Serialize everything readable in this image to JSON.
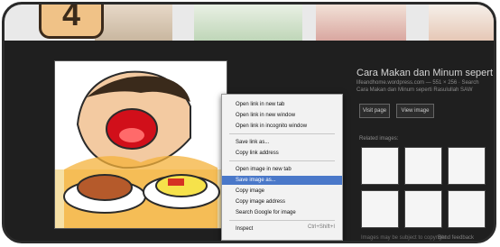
{
  "step": {
    "number": "4"
  },
  "info": {
    "title": "Cara Makan dan Minum sepert",
    "subtitle": "lifeandhome.wordpress.com — 551 × 256 · Search",
    "subtitle2": "Cara Makan dan Minum seperti Rasulullah SAW",
    "visit_label": "Visit page",
    "view_label": "View image",
    "related_label": "Related images:",
    "bottom_left": "Images may be subject to copyright",
    "bottom_right": "Send feedback"
  },
  "context_menu": {
    "items": [
      {
        "label": "Open link in new tab"
      },
      {
        "label": "Open link in new window"
      },
      {
        "label": "Open link in incognito window"
      },
      {
        "label": "Save link as..."
      },
      {
        "label": "Copy link address"
      },
      {
        "label": "Open image in new tab"
      },
      {
        "label": "Save image as...",
        "highlighted": true
      },
      {
        "label": "Copy image"
      },
      {
        "label": "Copy image address"
      },
      {
        "label": "Search Google for image"
      },
      {
        "label": "Inspect",
        "hint": "Ctrl+Shift+I"
      }
    ]
  },
  "colors": {
    "highlight": "#4a78c9",
    "frame": "#2a2a2a",
    "step_badge": "#f0c287"
  }
}
